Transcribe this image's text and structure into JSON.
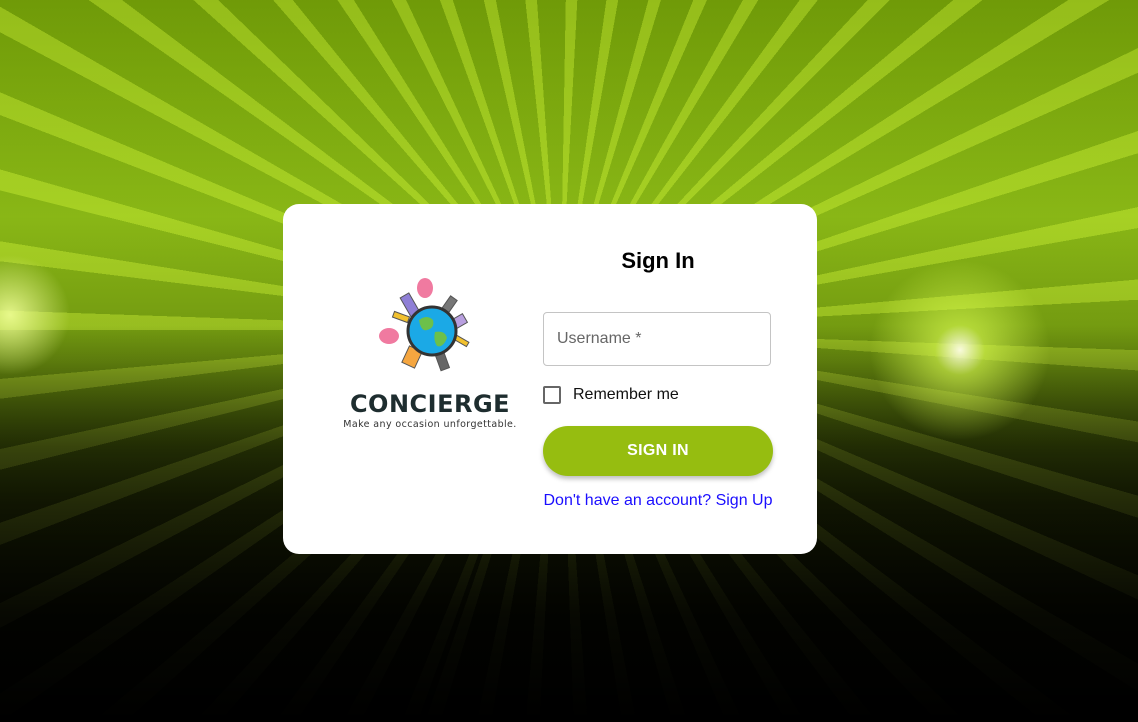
{
  "brand": {
    "name": "CONCIERGE",
    "tagline": "Make any occasion unforgettable."
  },
  "form": {
    "title": "Sign In",
    "username_placeholder": "Username *",
    "remember_label": "Remember me",
    "remember_checked": false,
    "submit_label": "SIGN IN",
    "signup_link": "Don't have an account? Sign Up"
  },
  "colors": {
    "accent": "#96bd10",
    "link": "#1a0dff",
    "brand_text": "#1e2d2f"
  }
}
